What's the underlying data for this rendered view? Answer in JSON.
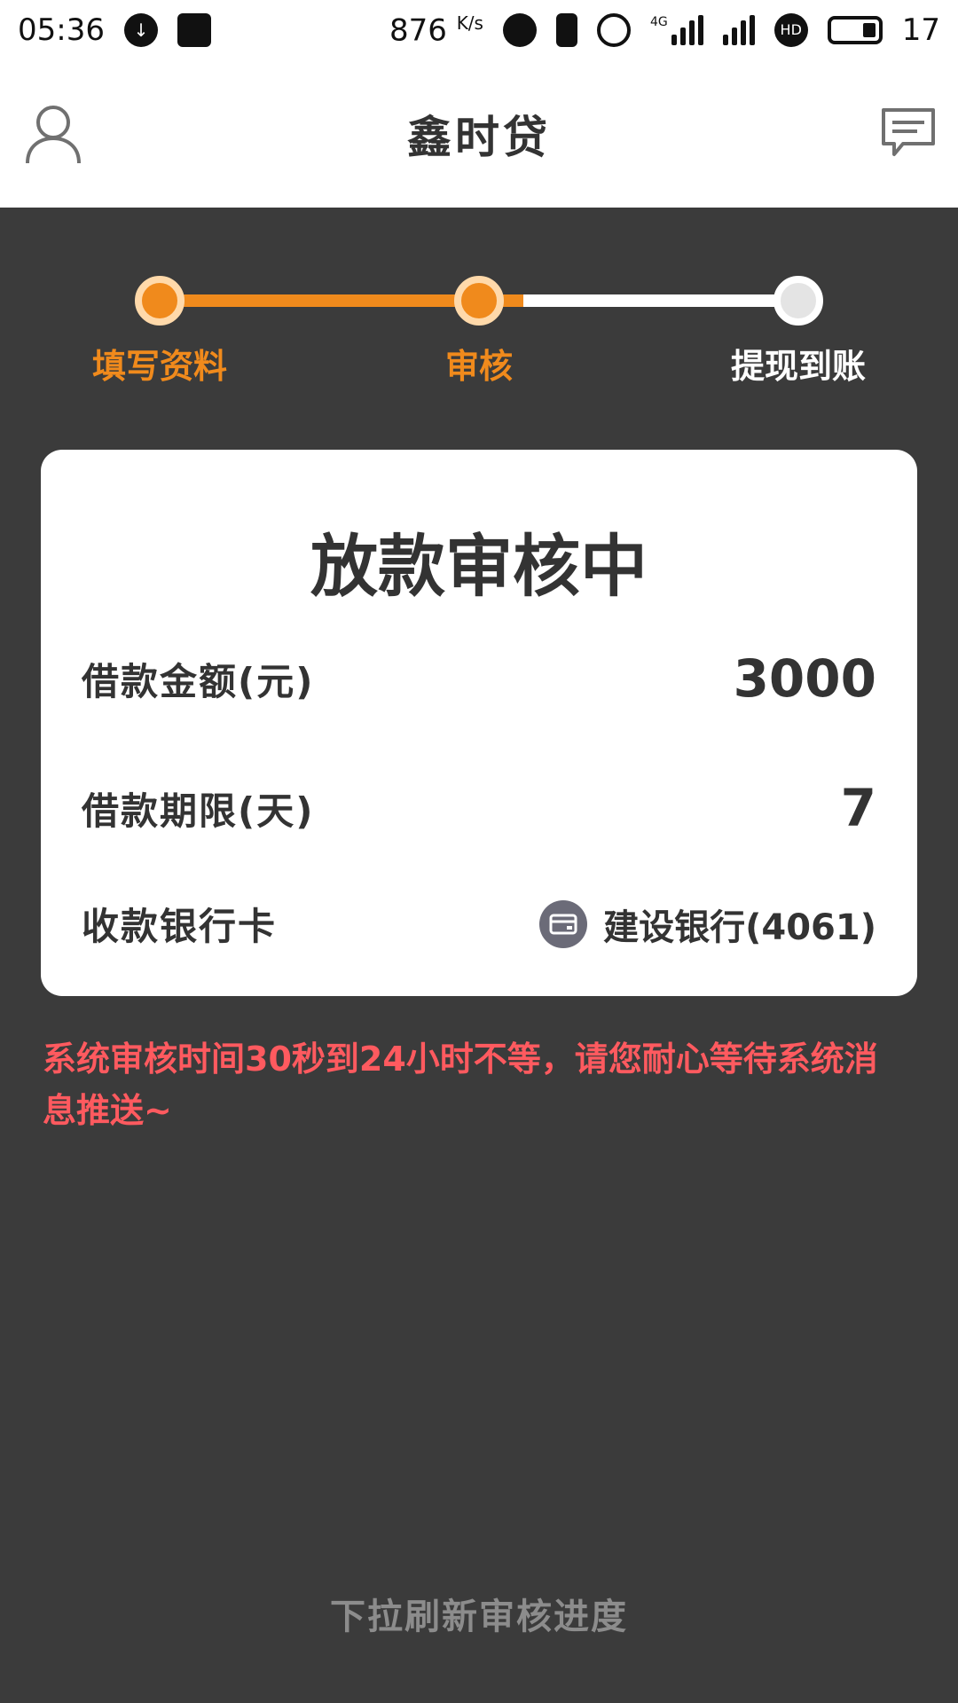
{
  "statusbar": {
    "time": "05:36",
    "net_speed": "876",
    "net_unit": "K/s",
    "network_type": "4G",
    "battery": "17"
  },
  "header": {
    "title": "鑫时贷"
  },
  "progress": {
    "steps": [
      {
        "label": "填写资料",
        "state": "done"
      },
      {
        "label": "审核",
        "state": "done"
      },
      {
        "label": "提现到账",
        "state": "todo"
      }
    ],
    "fill_fraction": 0.57,
    "accent_color": "#f08a1c"
  },
  "card": {
    "title": "放款审核中",
    "amount_label": "借款金额(元)",
    "amount_value": "3000",
    "term_label": "借款期限(天)",
    "term_value": "7",
    "bank_label": "收款银行卡",
    "bank_value": "建设银行(4061)",
    "bank_icon": "card-icon"
  },
  "notice": {
    "text": "系统审核时间30秒到24小时不等，请您耐心等待系统消息推送~",
    "color": "#ff5a5f"
  },
  "footer": {
    "pull_refresh": "下拉刷新审核进度"
  }
}
